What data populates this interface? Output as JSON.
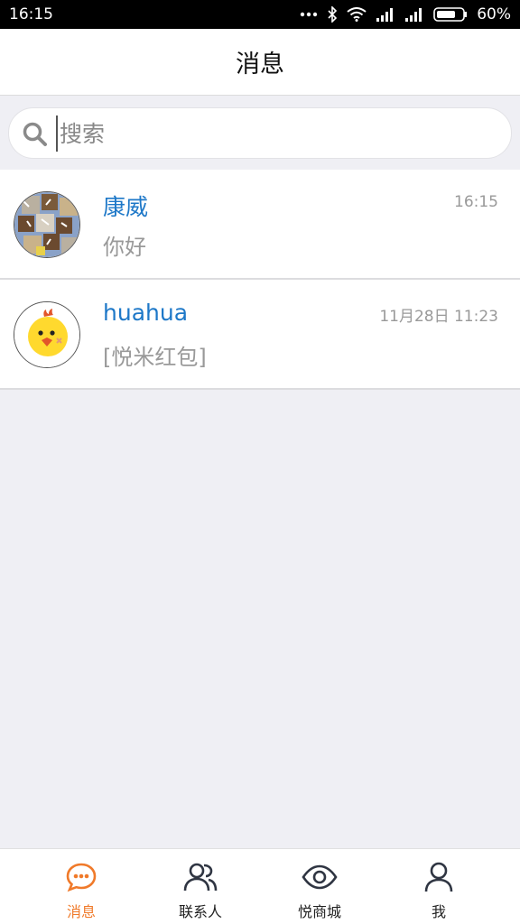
{
  "status_bar": {
    "time": "16:15",
    "battery": "60%",
    "icons": [
      "more-dots-icon",
      "bluetooth-icon",
      "wifi-icon",
      "signal-icon",
      "signal-icon",
      "battery-icon"
    ]
  },
  "header": {
    "title": "消息"
  },
  "search": {
    "placeholder": "搜索",
    "value": ""
  },
  "conversations": [
    {
      "name": "康威",
      "time": "16:15",
      "preview": "你好",
      "avatar": "quilt-pattern-photo"
    },
    {
      "name": "huahua",
      "time": "11月28日 11:23",
      "preview": "[悦米红包]",
      "avatar": "yellow-chick-cartoon"
    }
  ],
  "bottom_nav": {
    "items": [
      {
        "label": "消息",
        "icon": "chat-bubble-icon",
        "active": true
      },
      {
        "label": "联系人",
        "icon": "contacts-icon",
        "active": false
      },
      {
        "label": "悦商城",
        "icon": "eye-icon",
        "active": false
      },
      {
        "label": "我",
        "icon": "person-icon",
        "active": false
      }
    ]
  },
  "colors": {
    "accent": "#f07a2a",
    "name_blue": "#1e78c8",
    "background": "#efeff4"
  }
}
